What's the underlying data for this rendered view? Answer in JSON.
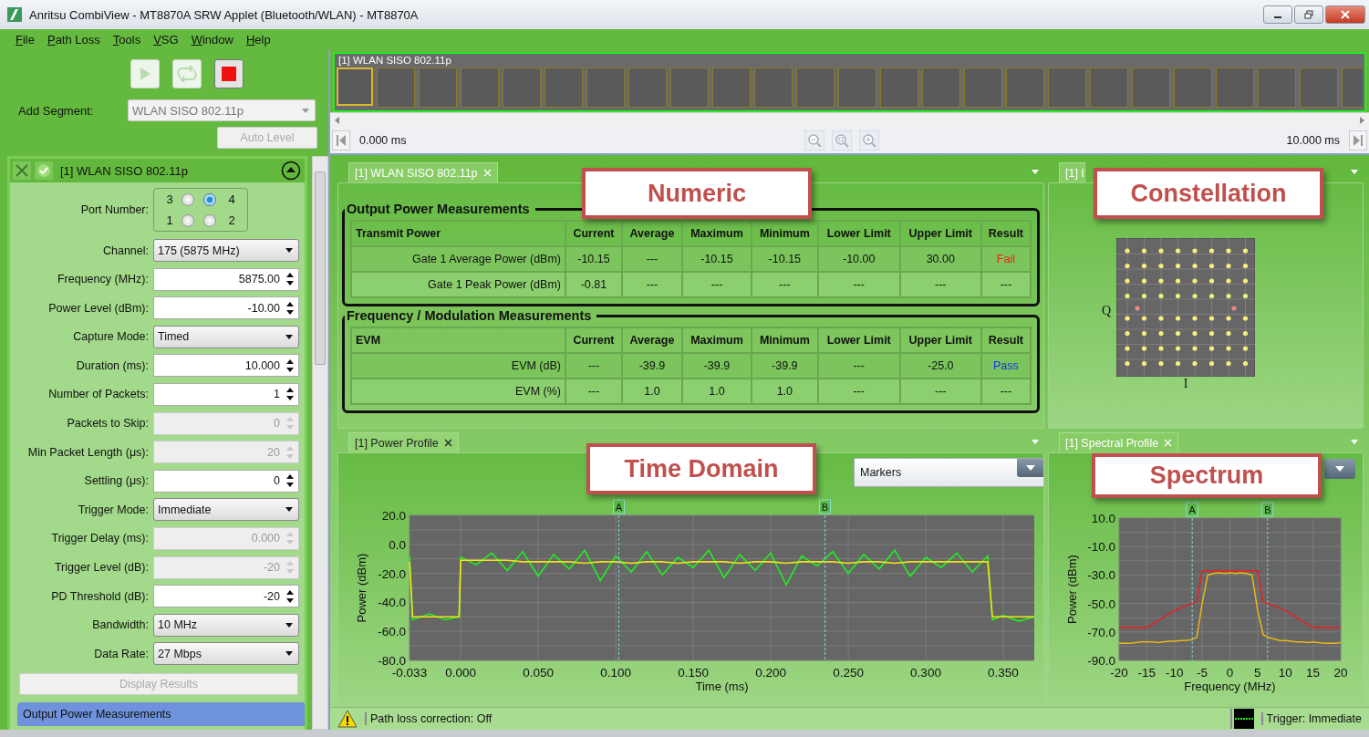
{
  "window": {
    "title": "Anritsu CombiView - MT8870A SRW Applet (Bluetooth/WLAN) - MT8870A"
  },
  "menu": [
    "File",
    "Path Loss",
    "Tools",
    "VSG",
    "Window",
    "Help"
  ],
  "toolbar": [
    {
      "kind": "play",
      "disabled": true
    },
    {
      "kind": "repeat",
      "disabled": true
    },
    {
      "kind": "stop",
      "disabled": false
    }
  ],
  "add_segment": {
    "label": "Add Segment:",
    "value": "WLAN SISO 802.11p",
    "disabled": true
  },
  "auto_level": {
    "label": "Auto Level",
    "disabled": true
  },
  "segment": {
    "title": "[1] WLAN SISO 802.11p",
    "expanded": true,
    "fields": [
      {
        "label": "Port Number:",
        "kind": "radio",
        "disabled": false,
        "options": [
          {
            "label": "3",
            "selected": false
          },
          {
            "label": "4",
            "selected": true
          },
          {
            "label": "1",
            "selected": false
          },
          {
            "label": "2",
            "selected": false
          }
        ]
      },
      {
        "label": "Channel:",
        "kind": "select",
        "value": "175 (5875 MHz)",
        "disabled": false
      },
      {
        "label": "Frequency (MHz):",
        "kind": "spin",
        "value": "5875.00",
        "disabled": false
      },
      {
        "label": "Power Level (dBm):",
        "kind": "spin",
        "value": "-10.00",
        "disabled": false
      },
      {
        "label": "Capture Mode:",
        "kind": "select",
        "value": "Timed",
        "disabled": false
      },
      {
        "label": "Duration (ms):",
        "kind": "spin",
        "value": "10.000",
        "disabled": false
      },
      {
        "label": "Number of Packets:",
        "kind": "spin",
        "value": "1",
        "disabled": false
      },
      {
        "label": "Packets to Skip:",
        "kind": "spin",
        "value": "0",
        "disabled": true
      },
      {
        "label": "Min Packet Length (μs):",
        "kind": "spin",
        "value": "20",
        "disabled": true
      },
      {
        "label": "Settling (μs):",
        "kind": "spin",
        "value": "0",
        "disabled": false
      },
      {
        "label": "Trigger Mode:",
        "kind": "select",
        "value": "Immediate",
        "disabled": false
      },
      {
        "label": "Trigger Delay (ms):",
        "kind": "spin",
        "value": "0.000",
        "disabled": true
      },
      {
        "label": "Trigger Level (dB):",
        "kind": "spin",
        "value": "-20",
        "disabled": true
      },
      {
        "label": "PD Threshold (dB):",
        "kind": "spin",
        "value": "-20",
        "disabled": false
      },
      {
        "label": "Bandwidth:",
        "kind": "select",
        "value": "10 MHz",
        "disabled": false
      },
      {
        "label": "Data Rate:",
        "kind": "select",
        "value": "27 Mbps",
        "disabled": false
      }
    ],
    "display_results": {
      "label": "Display Results",
      "disabled": true
    },
    "next_section": {
      "title": "Output Power Measurements"
    }
  },
  "capture": {
    "title": "[1] WLAN SISO 802.11p",
    "frames": [
      {
        "selected": true
      },
      {
        "selected": false
      },
      {
        "selected": false
      },
      {
        "selected": false
      },
      {
        "selected": false
      },
      {
        "selected": false
      },
      {
        "selected": false
      },
      {
        "selected": false
      },
      {
        "selected": false
      },
      {
        "selected": false
      },
      {
        "selected": false
      },
      {
        "selected": false
      },
      {
        "selected": false
      },
      {
        "selected": false
      },
      {
        "selected": false
      },
      {
        "selected": false
      },
      {
        "selected": false
      },
      {
        "selected": false
      },
      {
        "selected": false
      },
      {
        "selected": false
      },
      {
        "selected": false
      },
      {
        "selected": false
      },
      {
        "selected": false
      },
      {
        "selected": false
      },
      {
        "selected": false
      }
    ],
    "start": "0.000 ms",
    "end": "10.000 ms"
  },
  "numeric": {
    "tab": "[1] WLAN SISO 802.11p",
    "tab_selected": false,
    "callout": "Numeric",
    "sections": [
      {
        "title": "Output Power Measurements",
        "columns": [
          "Transmit Power",
          "Current",
          "Average",
          "Maximum",
          "Minimum",
          "Lower Limit",
          "Upper Limit",
          "Result"
        ],
        "rows": [
          {
            "cells": [
              "Gate 1 Average Power (dBm)",
              "-10.15",
              "---",
              "-10.15",
              "-10.15",
              "-10.00",
              "30.00",
              "Fail"
            ],
            "color": "#ee2211"
          },
          {
            "cells": [
              "Gate 1 Peak Power (dBm)",
              "-0.81",
              "---",
              "---",
              "---",
              "---",
              "---",
              "---"
            ]
          }
        ]
      },
      {
        "title": "Frequency / Modulation Measurements",
        "columns": [
          "EVM",
          "Current",
          "Average",
          "Maximum",
          "Minimum",
          "Lower Limit",
          "Upper Limit",
          "Result"
        ],
        "rows": [
          {
            "cells": [
              "EVM (dB)",
              "---",
              "-39.9",
              "-39.9",
              "-39.9",
              "---",
              "-25.0",
              "Pass"
            ],
            "color": "#1133ee"
          },
          {
            "cells": [
              "EVM (%)",
              "---",
              "1.0",
              "1.0",
              "1.0",
              "---",
              "---",
              "---"
            ]
          }
        ]
      }
    ]
  },
  "constellation": {
    "tab": "[1] I",
    "tab_selected": false,
    "callout": "Constellation",
    "q_label": "Q",
    "i_label": "I"
  },
  "power_profile": {
    "tab": "[1] Power Profile",
    "tab_selected": true,
    "callout": "Time Domain",
    "markers_value": "Markers",
    "chart_data": {
      "type": "line",
      "xlabel": "Time (ms)",
      "ylabel": "Power (dBm)",
      "x": [
        -0.033,
        -0.031,
        -0.02,
        -0.01,
        -0.001,
        0.0,
        0.01,
        0.02,
        0.03,
        0.04,
        0.05,
        0.06,
        0.07,
        0.08,
        0.09,
        0.1,
        0.11,
        0.12,
        0.13,
        0.14,
        0.15,
        0.16,
        0.17,
        0.18,
        0.19,
        0.2,
        0.21,
        0.22,
        0.23,
        0.24,
        0.25,
        0.26,
        0.27,
        0.28,
        0.29,
        0.3,
        0.31,
        0.32,
        0.33,
        0.34,
        0.343,
        0.35,
        0.36,
        0.37
      ],
      "series": [
        {
          "color": "#22ee22",
          "values": [
            -8,
            -52,
            -48,
            -52,
            -50,
            -9,
            -14,
            -6,
            -18,
            -5,
            -22,
            -7,
            -17,
            -4,
            -25,
            -8,
            -19,
            -5,
            -21,
            -9,
            -16,
            -4,
            -23,
            -7,
            -18,
            -6,
            -28,
            -8,
            -15,
            -5,
            -20,
            -7,
            -17,
            -4,
            -22,
            -9,
            -16,
            -6,
            -19,
            -8,
            -52,
            -49,
            -53,
            -50
          ]
        },
        {
          "color": "#f2e318",
          "values": [
            -12,
            -50,
            -50,
            -50,
            -50,
            -11,
            -11,
            -11,
            -11,
            -12,
            -12,
            -12,
            -12,
            -13,
            -12,
            -12,
            -13,
            -12,
            -12,
            -13,
            -12,
            -12,
            -12,
            -13,
            -12,
            -12,
            -13,
            -12,
            -12,
            -12,
            -13,
            -12,
            -12,
            -13,
            -12,
            -12,
            -12,
            -12,
            -12,
            -12,
            -50,
            -50,
            -50,
            -50
          ]
        }
      ],
      "xlim": [
        -0.033,
        0.37
      ],
      "ylim": [
        -80,
        20
      ],
      "grid": true,
      "xticks": [
        {
          "value": -0.033,
          "label": "-0.033"
        },
        {
          "value": 0,
          "label": "0.000"
        },
        {
          "value": 0.05,
          "label": "0.050"
        },
        {
          "value": 0.1,
          "label": "0.100"
        },
        {
          "value": 0.15,
          "label": "0.150"
        },
        {
          "value": 0.2,
          "label": "0.200"
        },
        {
          "value": 0.25,
          "label": "0.250"
        },
        {
          "value": 0.3,
          "label": "0.300"
        },
        {
          "value": 0.35,
          "label": "0.350"
        }
      ],
      "yticks": [
        {
          "value": 20,
          "label": "20.0"
        },
        {
          "value": 0,
          "label": "0.0"
        },
        {
          "value": -20,
          "label": "-20.0"
        },
        {
          "value": -40,
          "label": "-40.0"
        },
        {
          "value": -60,
          "label": "-60.0"
        },
        {
          "value": -80,
          "label": "-80.0"
        }
      ],
      "annotations": [
        {
          "text": "A",
          "x": 0.102
        },
        {
          "text": "B",
          "x": 0.235
        }
      ]
    }
  },
  "spectral_profile": {
    "tab": "[1] Spectral Profile",
    "tab_selected": false,
    "callout": "Spectrum",
    "chart_data": {
      "type": "line",
      "xlabel": "Frequency (MHz)",
      "ylabel": "Power (dBm)",
      "x": [
        -20,
        -19,
        -18,
        -17,
        -16,
        -15,
        -14,
        -13,
        -12,
        -11,
        -10,
        -9,
        -8,
        -7,
        -6,
        -5,
        -4,
        -3,
        -2,
        -1,
        0,
        1,
        2,
        3,
        4,
        5,
        6,
        7,
        8,
        9,
        10,
        11,
        12,
        13,
        14,
        15,
        16,
        17,
        18,
        19,
        20
      ],
      "series": [
        {
          "color": "#e82020",
          "values": [
            -67,
            -67,
            -67,
            -67,
            -67,
            -67,
            -64.6,
            -62.2,
            -59.8,
            -57.4,
            -55,
            -53.4,
            -51.8,
            -50.2,
            -48.6,
            -27,
            -27,
            -27,
            -27,
            -27,
            -27,
            -27,
            -27,
            -27,
            -27,
            -27,
            -48.6,
            -50.2,
            -51.8,
            -53.4,
            -55,
            -57.4,
            -59.8,
            -62.2,
            -64.6,
            -67,
            -67,
            -67,
            -67,
            -67,
            -67
          ]
        },
        {
          "color": "#e8b818",
          "values": [
            -78,
            -78,
            -78,
            -77.5,
            -77,
            -77,
            -77,
            -77.5,
            -77,
            -76.5,
            -76.5,
            -76,
            -76,
            -75.5,
            -74,
            -50,
            -30,
            -29,
            -28.5,
            -29,
            -28.5,
            -29,
            -28.5,
            -29,
            -30,
            -55,
            -72,
            -74,
            -75,
            -76,
            -76,
            -76.5,
            -77,
            -77,
            -77.5,
            -77,
            -77.5,
            -78,
            -78,
            -78,
            -77.5
          ]
        }
      ],
      "xlim": [
        -20,
        20
      ],
      "ylim": [
        -90,
        10
      ],
      "grid": true,
      "xticks": [
        -20,
        -15,
        -10,
        -5,
        0,
        5,
        10,
        15,
        20
      ],
      "yticks": [
        {
          "value": 10,
          "label": "10.0"
        },
        {
          "value": -10,
          "label": "-10.0"
        },
        {
          "value": -30,
          "label": "-30.0"
        },
        {
          "value": -50,
          "label": "-50.0"
        },
        {
          "value": -70,
          "label": "-70.0"
        },
        {
          "value": -90,
          "label": "-90.0"
        }
      ],
      "annotations": [
        {
          "text": "A",
          "x": -6.8
        },
        {
          "text": "B",
          "x": 6.8
        }
      ]
    }
  },
  "status_bar": {
    "path_loss": "Path loss correction: Off",
    "trigger": "Trigger: Immediate"
  }
}
